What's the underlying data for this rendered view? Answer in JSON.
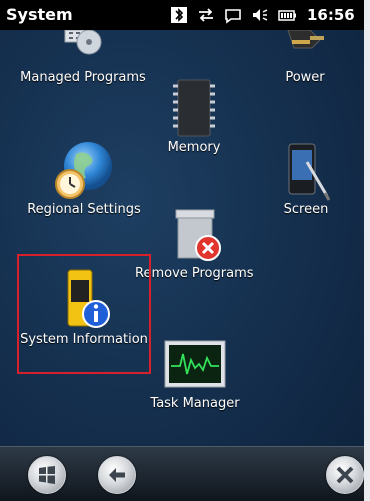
{
  "titlebar": {
    "title": "System",
    "clock": "16:56",
    "icons": [
      "bluetooth-icon",
      "connectivity-icon",
      "message-icon",
      "volume-icon",
      "battery-icon"
    ]
  },
  "items": {
    "managed_programs": "Managed Programs",
    "power": "Power",
    "memory": "Memory",
    "regional_settings": "Regional Settings",
    "screen": "Screen",
    "remove_programs": "Remove Programs",
    "system_information": "System Information",
    "task_manager": "Task Manager"
  },
  "bottombar": {
    "icons": [
      "start-icon",
      "back-icon",
      "close-icon"
    ]
  },
  "colors": {
    "highlight": "#d7202a",
    "titlebar_bg": "#000000",
    "background": "#15304f"
  }
}
